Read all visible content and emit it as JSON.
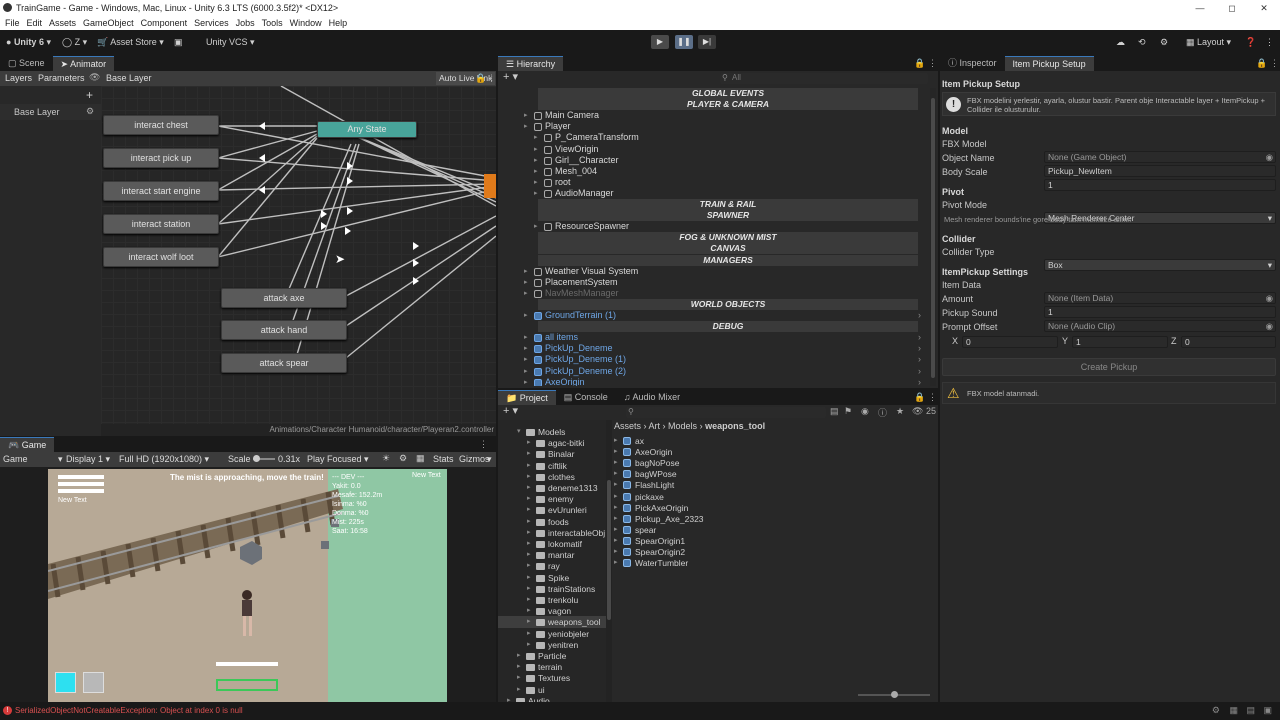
{
  "window": {
    "title": "TrainGame - Game - Windows, Mac, Linux - Unity 6.3 LTS (6000.3.5f2)* <DX12>"
  },
  "menu": [
    "File",
    "Edit",
    "Assets",
    "GameObject",
    "Component",
    "Services",
    "Jobs",
    "Tools",
    "Window",
    "Help"
  ],
  "toolbar": {
    "account": "Unity 6",
    "user": "Z",
    "asset_store": "Asset Store",
    "vcs": "Unity VCS",
    "layout": "Layout"
  },
  "animator": {
    "tabs": [
      "Scene",
      "Animator"
    ],
    "sub_tabs": [
      "Layers",
      "Parameters"
    ],
    "breadcrumb": "Base Layer",
    "auto_live_link": "Auto Live Link",
    "layer_name": "Base Layer",
    "any_state": "Any State",
    "states": [
      "interact chest",
      "interact pick up",
      "interact start engine",
      "interact station",
      "interact wolf loot",
      "attack axe",
      "attack hand",
      "attack spear"
    ],
    "path": "Animations/Character Humanoid/character/Playeran2.controller"
  },
  "game": {
    "tab": "Game",
    "mode": "Game",
    "display": "Display 1",
    "resolution": "Full HD (1920x1080)",
    "scale_label": "Scale",
    "scale_value": "0.31x",
    "play_focused": "Play Focused",
    "stats": "Stats",
    "gizmos": "Gizmos",
    "hud_new_text_left": "New Text",
    "hud_new_text_right": "New Text",
    "hud_message": "The mist is approaching, move the train!",
    "dev_lines": [
      "--- DEV ---",
      "Yakit: 0.0",
      "Mesafe: 152.2m",
      "Isinma: %0",
      "Donma: %0",
      "Mist: 225s",
      "Saat: 16:58"
    ]
  },
  "hierarchy": {
    "tab": "Hierarchy",
    "search_placeholder": "All",
    "rows": [
      {
        "kind": "group",
        "text": "GLOBAL EVENTS"
      },
      {
        "kind": "group",
        "text": "PLAYER & CAMERA"
      },
      {
        "kind": "item",
        "text": "Main Camera",
        "indent": 0
      },
      {
        "kind": "item",
        "text": "Player",
        "indent": 0
      },
      {
        "kind": "item",
        "text": "P_CameraTransform",
        "indent": 1
      },
      {
        "kind": "item",
        "text": "ViewOrigin",
        "indent": 1
      },
      {
        "kind": "item",
        "text": "Girl__Character",
        "indent": 1
      },
      {
        "kind": "item",
        "text": "Mesh_004",
        "indent": 1
      },
      {
        "kind": "item",
        "text": "root",
        "indent": 1
      },
      {
        "kind": "item",
        "text": "AudioManager",
        "indent": 1
      },
      {
        "kind": "group",
        "text": "TRAIN & RAIL"
      },
      {
        "kind": "group",
        "text": "SPAWNER"
      },
      {
        "kind": "item",
        "text": "ResourceSpawner",
        "indent": 1
      },
      {
        "kind": "group",
        "text": "FOG & UNKNOWN MIST"
      },
      {
        "kind": "group",
        "text": "CANVAS"
      },
      {
        "kind": "group",
        "text": "MANAGERS"
      },
      {
        "kind": "item",
        "text": "Weather Visual System",
        "indent": 0
      },
      {
        "kind": "item",
        "text": "PlacementSystem",
        "indent": 0
      },
      {
        "kind": "disabled",
        "text": "NavMeshManager",
        "indent": 0
      },
      {
        "kind": "group",
        "text": "WORLD OBJECTS"
      },
      {
        "kind": "prefab",
        "text": "GroundTerrain (1)",
        "indent": 0
      },
      {
        "kind": "group",
        "text": "DEBUG"
      },
      {
        "kind": "prefab",
        "text": "all items",
        "indent": 0
      },
      {
        "kind": "prefab",
        "text": "PickUp_Deneme",
        "indent": 0
      },
      {
        "kind": "prefab",
        "text": "PickUp_Deneme (1)",
        "indent": 0
      },
      {
        "kind": "prefab",
        "text": "PickUp_Deneme (2)",
        "indent": 0
      },
      {
        "kind": "prefab",
        "text": "AxeOrigin",
        "indent": 0
      }
    ]
  },
  "project": {
    "tabs": [
      "Project",
      "Console",
      "Audio Mixer"
    ],
    "breadcrumb": [
      "Assets",
      "Art",
      "Models",
      "weapons_tool"
    ],
    "count": "25",
    "folders": [
      {
        "text": "Models",
        "indent": 0
      },
      {
        "text": "agac-bitki",
        "indent": 1
      },
      {
        "text": "Binalar",
        "indent": 1
      },
      {
        "text": "ciftlik",
        "indent": 1
      },
      {
        "text": "clothes",
        "indent": 1
      },
      {
        "text": "deneme1313",
        "indent": 1
      },
      {
        "text": "enemy",
        "indent": 1
      },
      {
        "text": "evUrunleri",
        "indent": 1
      },
      {
        "text": "foods",
        "indent": 1
      },
      {
        "text": "interactableObj",
        "indent": 1
      },
      {
        "text": "lokomatif",
        "indent": 1
      },
      {
        "text": "mantar",
        "indent": 1
      },
      {
        "text": "ray",
        "indent": 1
      },
      {
        "text": "Spike",
        "indent": 1
      },
      {
        "text": "trainStations",
        "indent": 1
      },
      {
        "text": "trenkolu",
        "indent": 1
      },
      {
        "text": "vagon",
        "indent": 1
      },
      {
        "text": "weapons_tool",
        "indent": 1
      },
      {
        "text": "yeniobjeler",
        "indent": 1
      },
      {
        "text": "yenitren",
        "indent": 1
      },
      {
        "text": "Particle",
        "indent": 0
      },
      {
        "text": "terrain",
        "indent": 0
      },
      {
        "text": "Textures",
        "indent": 0
      },
      {
        "text": "ui",
        "indent": 0
      },
      {
        "text": "Audio",
        "indent": -1
      }
    ],
    "files": [
      "ax",
      "AxeOrigin",
      "bagNoPose",
      "bagWPose",
      "FlashLight",
      "pickaxe",
      "PickAxeOrigin",
      "Pickup_Axe_2323",
      "spear",
      "SpearOrigin1",
      "SpearOrigin2",
      "WaterTumbler"
    ]
  },
  "inspector": {
    "tabs": [
      "Inspector",
      "Item Pickup Setup"
    ],
    "title": "Item Pickup Setup",
    "info": "FBX modelini yerlestir, ayarla, olustur bastir. Parent obje Interactable layer + ItemPickup + Collider ile olusturulur.",
    "model_section": "Model",
    "fbx_label": "FBX Model",
    "fbx_value": "None (Game Object)",
    "name_label": "Object Name",
    "name_value": "Pickup_NewItem",
    "scale_label": "Body Scale",
    "scale_value": "1",
    "pivot_section": "Pivot",
    "pivot_label": "Pivot Mode",
    "pivot_value": "Mesh Renderer Center",
    "pivot_hint": "Mesh renderer bounds'ine gore body tam merkeze alinir.",
    "collider_section": "Collider",
    "collider_label": "Collider Type",
    "collider_value": "Box",
    "settings_section": "ItemPickup Settings",
    "itemdata_label": "Item Data",
    "itemdata_value": "None (Item Data)",
    "amount_label": "Amount",
    "amount_value": "1",
    "sound_label": "Pickup Sound",
    "sound_value": "None (Audio Clip)",
    "offset_label": "Prompt Offset",
    "offset": {
      "x_label": "X",
      "x": "0",
      "y_label": "Y",
      "y": "1",
      "z_label": "Z",
      "z": "0"
    },
    "create_button": "Create Pickup",
    "warning": "FBX model atanmadi."
  },
  "status": {
    "error": "SerializedObjectNotCreatableException: Object at index 0 is null"
  }
}
